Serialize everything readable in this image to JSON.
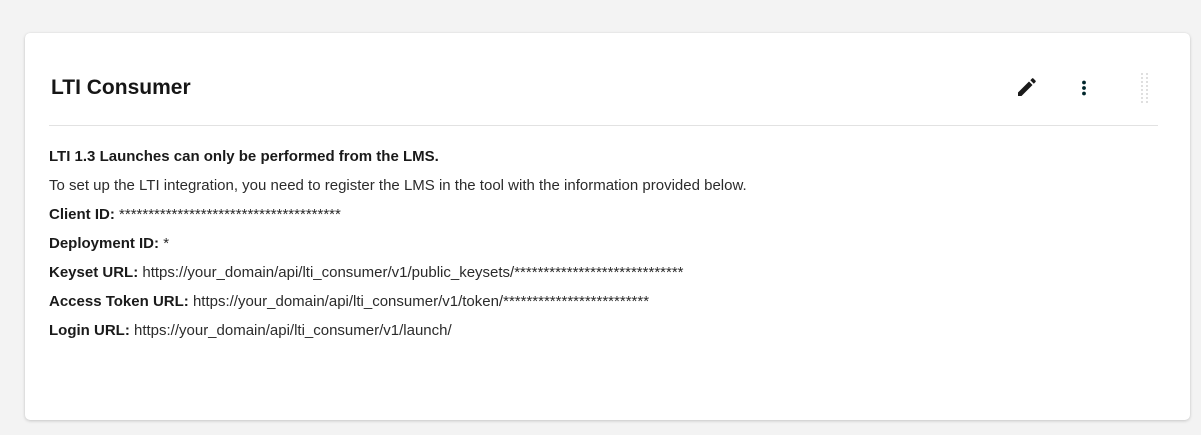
{
  "card": {
    "title": "LTI Consumer",
    "actions": {
      "edit_icon": "pencil-icon",
      "more_icon": "kebab-menu-icon",
      "drag_icon": "drag-handle-icon"
    }
  },
  "body": {
    "notice": "LTI 1.3 Launches can only be performed from the LMS.",
    "instructions": "To set up the LTI integration, you need to register the LMS in the tool with the information provided below.",
    "fields": [
      {
        "label": "Client ID:",
        "value": "**************************************"
      },
      {
        "label": "Deployment ID:",
        "value": "*"
      },
      {
        "label": "Keyset URL:",
        "value": "https://your_domain/api/lti_consumer/v1/public_keysets/*****************************"
      },
      {
        "label": "Access Token URL:",
        "value": "https://your_domain/api/lti_consumer/v1/token/*************************"
      },
      {
        "label": "Login URL:",
        "value": "https://your_domain/api/lti_consumer/v1/launch/"
      }
    ]
  },
  "colors": {
    "page_background": "#f3f3f3",
    "card_background": "#ffffff",
    "text": "#2b2b2b",
    "divider": "#e2e2e2",
    "icon": "#1a1a1a",
    "menu_icon": "#00262b"
  }
}
